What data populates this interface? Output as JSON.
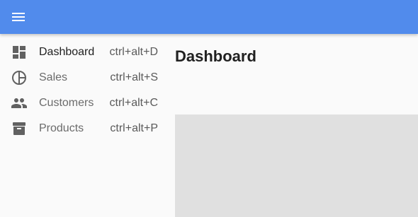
{
  "app_bar": {
    "menu_icon": "menu-icon",
    "accent_color": "#518bec"
  },
  "sidebar": {
    "selected": "Dashboard",
    "items": [
      {
        "label": "Dashboard",
        "shortcut": "ctrl+alt+D",
        "icon": "dashboard-icon"
      },
      {
        "label": "Sales",
        "shortcut": "ctrl+alt+S",
        "icon": "pie-chart-icon"
      },
      {
        "label": "Customers",
        "shortcut": "ctrl+alt+C",
        "icon": "people-icon"
      },
      {
        "label": "Products",
        "shortcut": "ctrl+alt+P",
        "icon": "archive-icon"
      }
    ]
  },
  "main": {
    "title": "Dashboard"
  }
}
